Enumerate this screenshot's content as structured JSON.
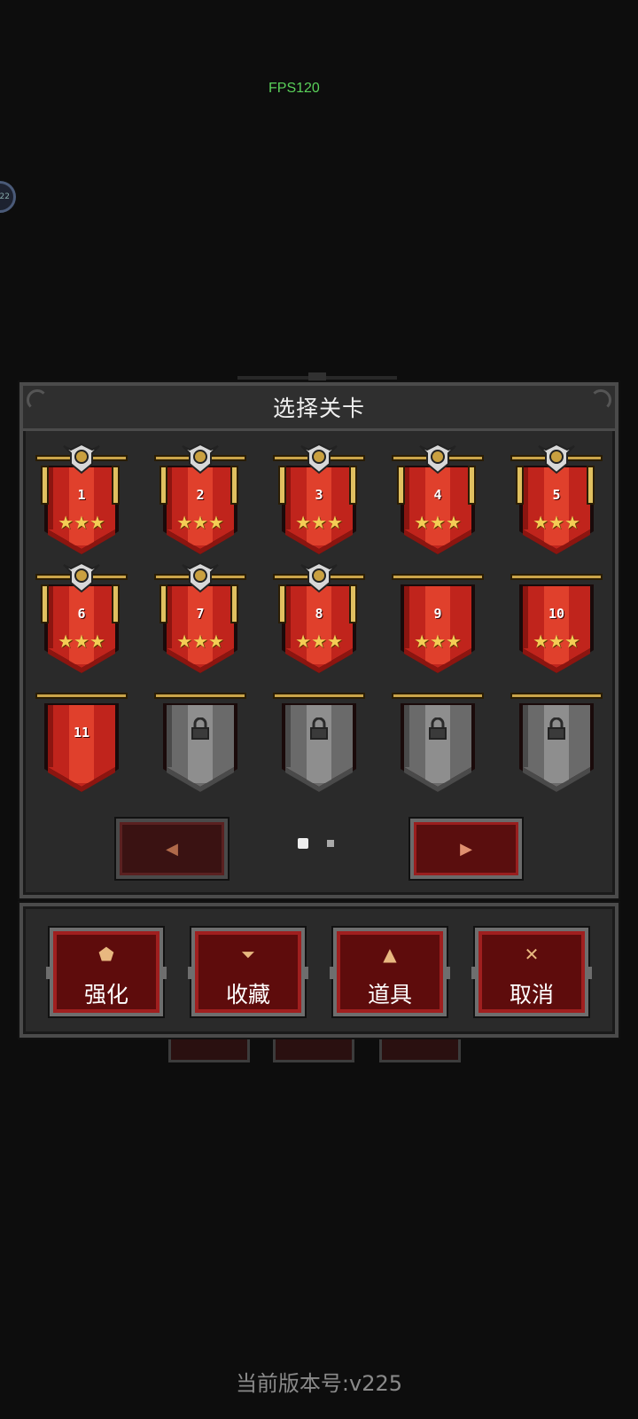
{
  "fps": "FPS120",
  "side_bubble": "22",
  "dialog": {
    "title": "选择关卡",
    "levels": [
      {
        "label": "1",
        "state": "cleared",
        "stars": "★★★"
      },
      {
        "label": "2",
        "state": "cleared",
        "stars": "★★★"
      },
      {
        "label": "3",
        "state": "cleared",
        "stars": "★★★"
      },
      {
        "label": "4",
        "state": "cleared",
        "stars": "★★★"
      },
      {
        "label": "5",
        "state": "cleared",
        "stars": "★★★"
      },
      {
        "label": "6",
        "state": "cleared",
        "stars": "★★★"
      },
      {
        "label": "7",
        "state": "cleared",
        "stars": "★★★"
      },
      {
        "label": "8",
        "state": "cleared",
        "stars": "★★★"
      },
      {
        "label": "9",
        "state": "cleared",
        "stars": "★★★"
      },
      {
        "label": "10",
        "state": "cleared",
        "stars": "★★★"
      },
      {
        "label": "11",
        "state": "open",
        "stars": ""
      },
      {
        "label": "",
        "state": "locked",
        "stars": ""
      },
      {
        "label": "",
        "state": "locked",
        "stars": ""
      },
      {
        "label": "",
        "state": "locked",
        "stars": ""
      },
      {
        "label": "",
        "state": "locked",
        "stars": ""
      }
    ],
    "prev_arrow": "◀",
    "next_arrow": "▶"
  },
  "actions": {
    "upgrade": "强化",
    "collection": "收藏",
    "items": "道具",
    "cancel": "取消"
  },
  "version": "当前版本号:v225",
  "colors": {
    "banner_red": "#c0241c",
    "banner_gray": "#6a6a6a",
    "star": "#f4cd55",
    "gold": "#caa44a"
  }
}
